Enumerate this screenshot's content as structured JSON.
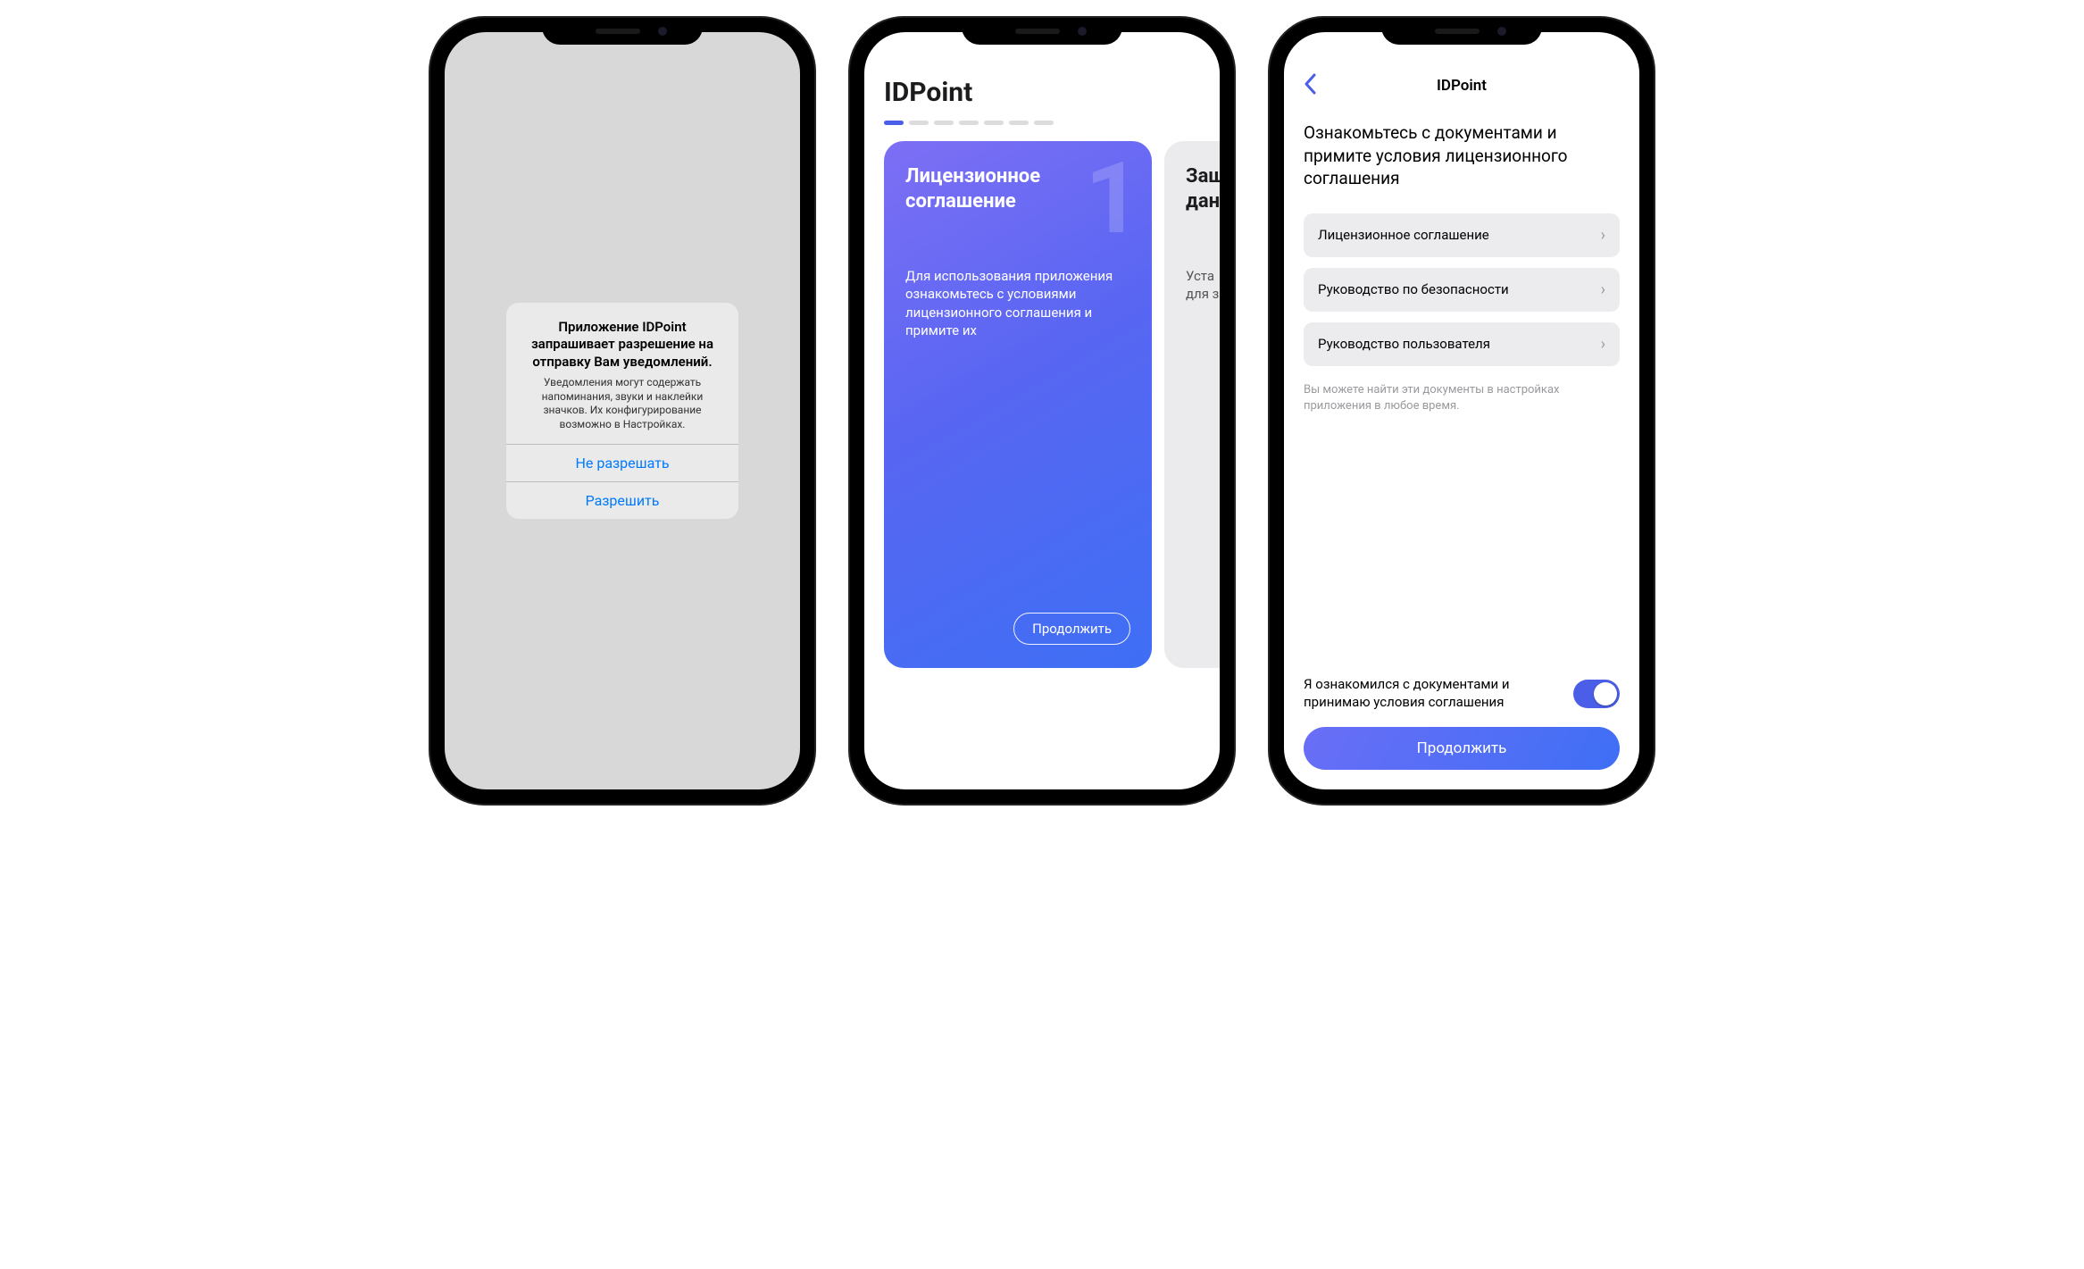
{
  "screen1": {
    "alert": {
      "title": "Приложение  IDPoint запрашивает разрешение на отправку Вам уведомлений.",
      "message": "Уведомления могут содержать напоминания, звуки и наклейки значков. Их конфигурирование возможно в Настройках.",
      "deny": "Не разрешать",
      "allow": "Разрешить"
    }
  },
  "screen2": {
    "title": "IDPoint",
    "card1": {
      "number": "1",
      "title": "Лицензионное соглашение",
      "desc": "Для использования приложения ознакомьтесь с условиями лицензионного соглашения и примите их",
      "button": "Продолжить"
    },
    "card2": {
      "title_line1": "Защ",
      "title_line2": "дан",
      "desc_line1": "Уста",
      "desc_line2": "для з"
    }
  },
  "screen3": {
    "nav_title": "IDPoint",
    "intro": "Ознакомьтесь с документами и примите условия лицензионного соглашения",
    "docs": [
      "Лицензионное соглашение",
      "Руководство по безопасности",
      "Руководство пользователя"
    ],
    "hint": "Вы можете найти эти документы в настройках приложения в любое время.",
    "consent": "Я ознакомился с документами и принимаю условия соглашения",
    "continue": "Продолжить"
  }
}
